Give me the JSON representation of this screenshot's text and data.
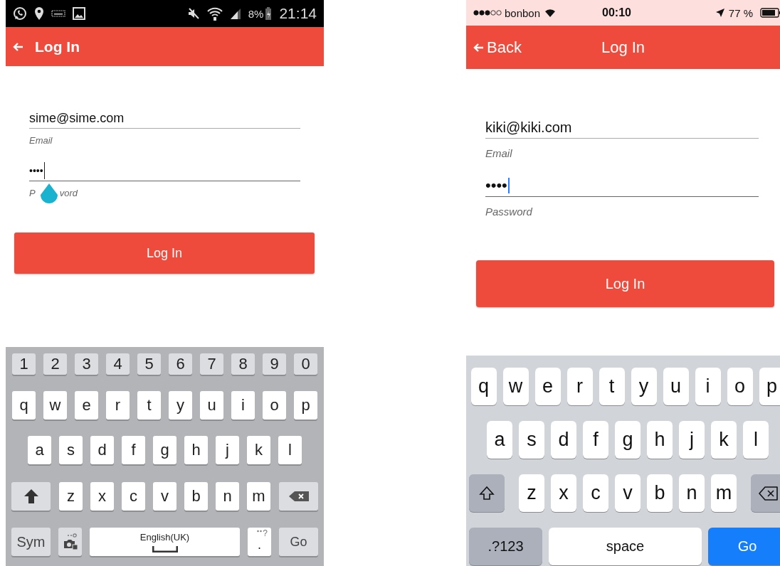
{
  "phones": [
    {
      "kind": "android",
      "status_bar": {
        "battery": "8%",
        "time": "21:14"
      },
      "app_bar": {
        "title": "Log In"
      },
      "fields": [
        {
          "kind": "text",
          "value": "sime@sime.com",
          "label": "Email",
          "focused": false
        },
        {
          "kind": "password",
          "value": "••••",
          "label_parts": [
            "P",
            "vord"
          ],
          "focused": true
        }
      ],
      "login_button": "Log In",
      "keyboard": {
        "rows": [
          {
            "keys": [
              {
                "kind": "digit",
                "label": "1"
              },
              {
                "kind": "digit",
                "label": "2"
              },
              {
                "kind": "digit",
                "label": "3"
              },
              {
                "kind": "digit",
                "label": "4"
              },
              {
                "kind": "digit",
                "label": "5"
              },
              {
                "kind": "digit",
                "label": "6"
              },
              {
                "kind": "digit",
                "label": "7"
              },
              {
                "kind": "digit",
                "label": "8"
              },
              {
                "kind": "digit",
                "label": "9"
              },
              {
                "kind": "digit",
                "label": "0"
              }
            ]
          },
          {
            "keys": [
              {
                "kind": "char",
                "label": "q"
              },
              {
                "kind": "char",
                "label": "w"
              },
              {
                "kind": "char",
                "label": "e"
              },
              {
                "kind": "char",
                "label": "r"
              },
              {
                "kind": "char",
                "label": "t"
              },
              {
                "kind": "char",
                "label": "y"
              },
              {
                "kind": "char",
                "label": "u"
              },
              {
                "kind": "char",
                "label": "i"
              },
              {
                "kind": "char",
                "label": "o"
              },
              {
                "kind": "char",
                "label": "p"
              }
            ]
          },
          {
            "keys": [
              {
                "kind": "char",
                "label": "a"
              },
              {
                "kind": "char",
                "label": "s"
              },
              {
                "kind": "char",
                "label": "d"
              },
              {
                "kind": "char",
                "label": "f"
              },
              {
                "kind": "char",
                "label": "g"
              },
              {
                "kind": "char",
                "label": "h"
              },
              {
                "kind": "char",
                "label": "j"
              },
              {
                "kind": "char",
                "label": "k"
              },
              {
                "kind": "char",
                "label": "l"
              }
            ]
          },
          {
            "keys": [
              {
                "kind": "shift"
              },
              {
                "kind": "char",
                "label": "z"
              },
              {
                "kind": "char",
                "label": "x"
              },
              {
                "kind": "char",
                "label": "c"
              },
              {
                "kind": "char",
                "label": "v"
              },
              {
                "kind": "char",
                "label": "b"
              },
              {
                "kind": "char",
                "label": "n"
              },
              {
                "kind": "char",
                "label": "m"
              },
              {
                "kind": "backspace"
              }
            ]
          },
          {
            "keys": [
              {
                "kind": "fn",
                "label": "Sym"
              },
              {
                "kind": "camera"
              },
              {
                "kind": "space",
                "label": "English(UK)"
              },
              {
                "kind": "period",
                "label": ".",
                "hint": "?"
              },
              {
                "kind": "go",
                "label": "Go"
              }
            ]
          }
        ]
      }
    },
    {
      "kind": "ios",
      "status_bar": {
        "carrier": "bonbon",
        "time": "00:10",
        "battery": "77 %"
      },
      "app_bar": {
        "back_label": "Back",
        "title": "Log In"
      },
      "fields": [
        {
          "kind": "text",
          "value": "kiki@kiki.com",
          "label": "Email",
          "focused": false
        },
        {
          "kind": "password",
          "value": "••••",
          "label": "Password",
          "focused": true
        }
      ],
      "login_button": "Log In",
      "keyboard": {
        "rows": [
          {
            "keys": [
              {
                "kind": "char",
                "label": "q"
              },
              {
                "kind": "char",
                "label": "w"
              },
              {
                "kind": "char",
                "label": "e"
              },
              {
                "kind": "char",
                "label": "r"
              },
              {
                "kind": "char",
                "label": "t"
              },
              {
                "kind": "char",
                "label": "y"
              },
              {
                "kind": "char",
                "label": "u"
              },
              {
                "kind": "char",
                "label": "i"
              },
              {
                "kind": "char",
                "label": "o"
              },
              {
                "kind": "char",
                "label": "p"
              }
            ]
          },
          {
            "keys": [
              {
                "kind": "char",
                "label": "a"
              },
              {
                "kind": "char",
                "label": "s"
              },
              {
                "kind": "char",
                "label": "d"
              },
              {
                "kind": "char",
                "label": "f"
              },
              {
                "kind": "char",
                "label": "g"
              },
              {
                "kind": "char",
                "label": "h"
              },
              {
                "kind": "char",
                "label": "j"
              },
              {
                "kind": "char",
                "label": "k"
              },
              {
                "kind": "char",
                "label": "l"
              }
            ]
          },
          {
            "keys": [
              {
                "kind": "shift"
              },
              {
                "kind": "char",
                "label": "z"
              },
              {
                "kind": "char",
                "label": "x"
              },
              {
                "kind": "char",
                "label": "c"
              },
              {
                "kind": "char",
                "label": "v"
              },
              {
                "kind": "char",
                "label": "b"
              },
              {
                "kind": "char",
                "label": "n"
              },
              {
                "kind": "char",
                "label": "m"
              },
              {
                "kind": "backspace"
              }
            ]
          },
          {
            "keys": [
              {
                "kind": "fn",
                "label": ".?123"
              },
              {
                "kind": "space",
                "label": "space"
              },
              {
                "kind": "go",
                "label": "Go"
              }
            ]
          }
        ]
      }
    }
  ]
}
